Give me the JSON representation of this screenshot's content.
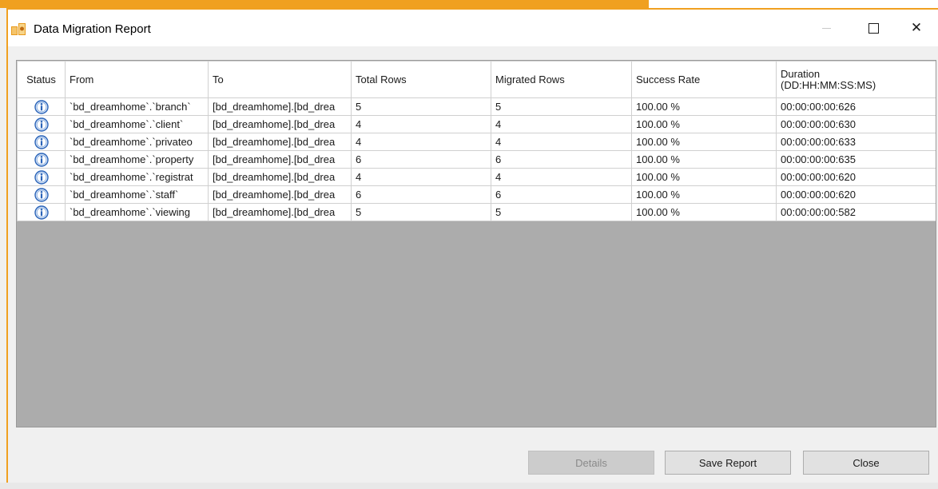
{
  "window": {
    "title": "Data Migration Report",
    "minimize_icon": "minimize-icon",
    "maximize_icon": "maximize-icon",
    "close_icon": "close-icon",
    "close_glyph": "✕"
  },
  "table": {
    "columns": {
      "status": "Status",
      "from": "From",
      "to": "To",
      "total_rows": "Total Rows",
      "migrated_rows": "Migrated Rows",
      "success_rate": "Success Rate",
      "duration_line1": "Duration",
      "duration_line2": "(DD:HH:MM:SS:MS)"
    },
    "rows": [
      {
        "status_icon": "info-icon",
        "from": "`bd_dreamhome`.`branch`",
        "to": "[bd_dreamhome].[bd_drea",
        "total_rows": "5",
        "migrated_rows": "5",
        "success_rate": "100.00 %",
        "duration": "00:00:00:00:626"
      },
      {
        "status_icon": "info-icon",
        "from": "`bd_dreamhome`.`client`",
        "to": "[bd_dreamhome].[bd_drea",
        "total_rows": "4",
        "migrated_rows": "4",
        "success_rate": "100.00 %",
        "duration": "00:00:00:00:630"
      },
      {
        "status_icon": "info-icon",
        "from": "`bd_dreamhome`.`privateo",
        "to": "[bd_dreamhome].[bd_drea",
        "total_rows": "4",
        "migrated_rows": "4",
        "success_rate": "100.00 %",
        "duration": "00:00:00:00:633"
      },
      {
        "status_icon": "info-icon",
        "from": "`bd_dreamhome`.`property",
        "to": "[bd_dreamhome].[bd_drea",
        "total_rows": "6",
        "migrated_rows": "6",
        "success_rate": "100.00 %",
        "duration": "00:00:00:00:635"
      },
      {
        "status_icon": "info-icon",
        "from": "`bd_dreamhome`.`registrat",
        "to": "[bd_dreamhome].[bd_drea",
        "total_rows": "4",
        "migrated_rows": "4",
        "success_rate": "100.00 %",
        "duration": "00:00:00:00:620"
      },
      {
        "status_icon": "info-icon",
        "from": "`bd_dreamhome`.`staff`",
        "to": "[bd_dreamhome].[bd_drea",
        "total_rows": "6",
        "migrated_rows": "6",
        "success_rate": "100.00 %",
        "duration": "00:00:00:00:620"
      },
      {
        "status_icon": "info-icon",
        "from": "`bd_dreamhome`.`viewing",
        "to": "[bd_dreamhome].[bd_drea",
        "total_rows": "5",
        "migrated_rows": "5",
        "success_rate": "100.00 %",
        "duration": "00:00:00:00:582"
      }
    ]
  },
  "buttons": {
    "details": "Details",
    "save_report": "Save Report",
    "close": "Close"
  },
  "colors": {
    "accent_orange": "#f0a020",
    "grid_empty_area": "#acacac",
    "info_icon_blue": "#2a63b8"
  }
}
